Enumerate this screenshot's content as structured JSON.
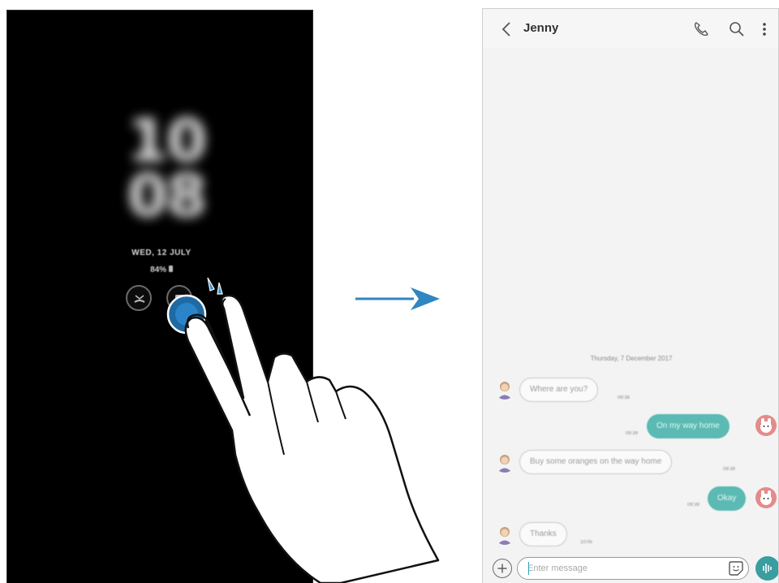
{
  "aod": {
    "clock": "10\n08",
    "date": "WED, 12 JULY",
    "battery": "84%"
  },
  "conversation": {
    "contact": "Jenny",
    "date_separator": "Thursday, 7 December 2017",
    "messages": [
      {
        "direction": "in",
        "text": "Where are you?",
        "time": "09:38"
      },
      {
        "direction": "out",
        "text": "On my way home",
        "time": "09:39"
      },
      {
        "direction": "in",
        "text": "Buy some oranges on the way home",
        "time": "09:39"
      },
      {
        "direction": "out",
        "text": "Okay",
        "time": "09:39"
      },
      {
        "direction": "in",
        "text": "Thanks",
        "time": "10:05"
      }
    ]
  },
  "composer": {
    "placeholder": "Enter message"
  },
  "colors": {
    "accent_teal": "#5bbab3",
    "arrow_blue": "#2f86c1",
    "tap_blue": "#1f6aa3"
  },
  "icons": {
    "back": "chevron-left-icon",
    "call": "phone-icon",
    "search": "search-icon",
    "more": "more-vertical-icon",
    "attach": "plus-icon",
    "sticker": "sticker-icon",
    "voice": "microphone-icon",
    "reject": "reject-call-icon",
    "message": "message-icon"
  }
}
